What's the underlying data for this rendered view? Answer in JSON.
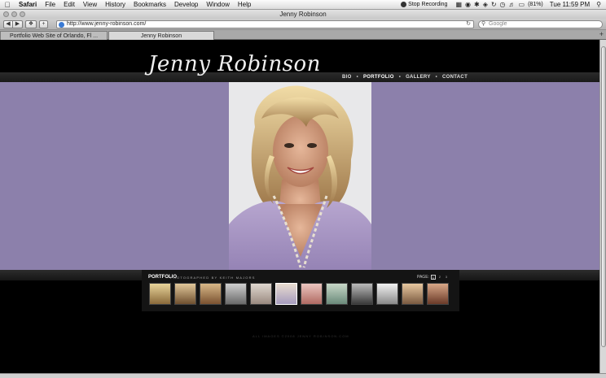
{
  "menubar": {
    "items": [
      "Safari",
      "File",
      "Edit",
      "View",
      "History",
      "Bookmarks",
      "Develop",
      "Window",
      "Help"
    ],
    "recording": "Stop Recording",
    "battery": "(81%)",
    "clock": "Tue 11:59 PM"
  },
  "window": {
    "title": "Jenny Robinson",
    "address": "http://www.jenny-robinson.com/",
    "search_placeholder": "Google",
    "tabs": [
      "Portfolio Web Site of Orlando, Fl ...",
      "Jenny Robinson"
    ]
  },
  "site": {
    "logo": "Jenny Robinson",
    "nav": [
      "BIO",
      "PORTFOLIO",
      "GALLERY",
      "CONTACT"
    ],
    "active_nav": "PORTFOLIO",
    "portfolio_title": "PORTFOLIO",
    "portfolio_subtitle": "PHOTOGRAPHED BY KEITH MAJORS",
    "page_label": "PAGE:",
    "pages": [
      "1",
      "2",
      "3"
    ],
    "current_page": "1",
    "thumb_count": 12,
    "selected_thumb": 5,
    "copyright": "ALL IMAGES ©2008 JENNY ROBINSON.COM"
  },
  "colors": {
    "band": "#8c80ab",
    "background": "#000000"
  }
}
